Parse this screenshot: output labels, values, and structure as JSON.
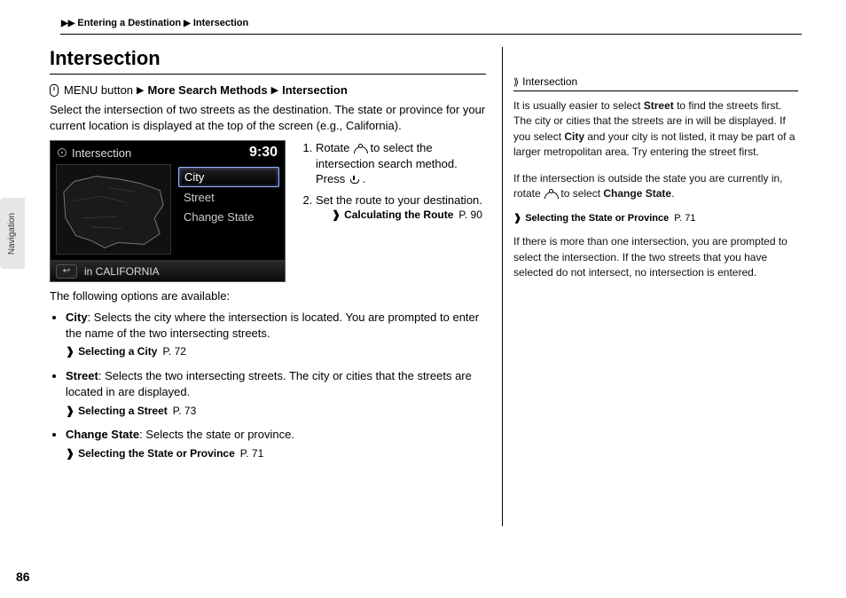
{
  "breadcrumb": {
    "level1": "Entering a Destination",
    "level2": "Intersection"
  },
  "title": "Intersection",
  "side_tab": "Navigation",
  "path": {
    "p1": "MENU button",
    "p2": "More Search Methods",
    "p3": "Intersection"
  },
  "intro": "Select the intersection of two streets as the destination. The state or province for your current location is displayed at the top of the screen (e.g., California).",
  "device": {
    "title": "Intersection",
    "time": "9:30",
    "items": [
      "City",
      "Street",
      "Change State"
    ],
    "state_line": "in CALIFORNIA"
  },
  "steps": {
    "s1a": "Rotate ",
    "s1b": " to select the intersection search method. Press ",
    "s1c": ".",
    "s2": "Set the route to your destination.",
    "xref2_label": "Calculating the Route",
    "xref2_page": "P. 90"
  },
  "avail_intro": "The following options are available:",
  "options": {
    "city": {
      "label": "City",
      "desc": ": Selects the city where the intersection is located. You are prompted to enter the name of the two intersecting streets.",
      "xref_label": "Selecting a City",
      "xref_page": "P. 72"
    },
    "street": {
      "label": "Street",
      "desc": ": Selects the two intersecting streets. The city or cities that the streets are located in are displayed.",
      "xref_label": "Selecting a Street",
      "xref_page": "P. 73"
    },
    "change_state": {
      "label": "Change State",
      "desc": ": Selects the state or province.",
      "xref_label": "Selecting the State or Province",
      "xref_page": "P. 71"
    }
  },
  "sidebar": {
    "head": "Intersection",
    "p1a": "It is usually easier to select ",
    "p1b": "Street",
    "p1c": " to find the streets first. The city or cities that the streets are in will be displayed. If you select ",
    "p1d": "City",
    "p1e": " and your city is not listed, it may be part of a larger metropolitan area. Try entering the street first.",
    "p2a": "If the intersection is outside the state you are currently in, rotate ",
    "p2b": " to select ",
    "p2c": "Change State",
    "p2d": ".",
    "xref_label": "Selecting the State or Province",
    "xref_page": "P. 71",
    "p3": "If there is more than one intersection, you are prompted to select the intersection. If the two streets that you have selected do not intersect, no intersection is entered."
  },
  "page_number": "86"
}
